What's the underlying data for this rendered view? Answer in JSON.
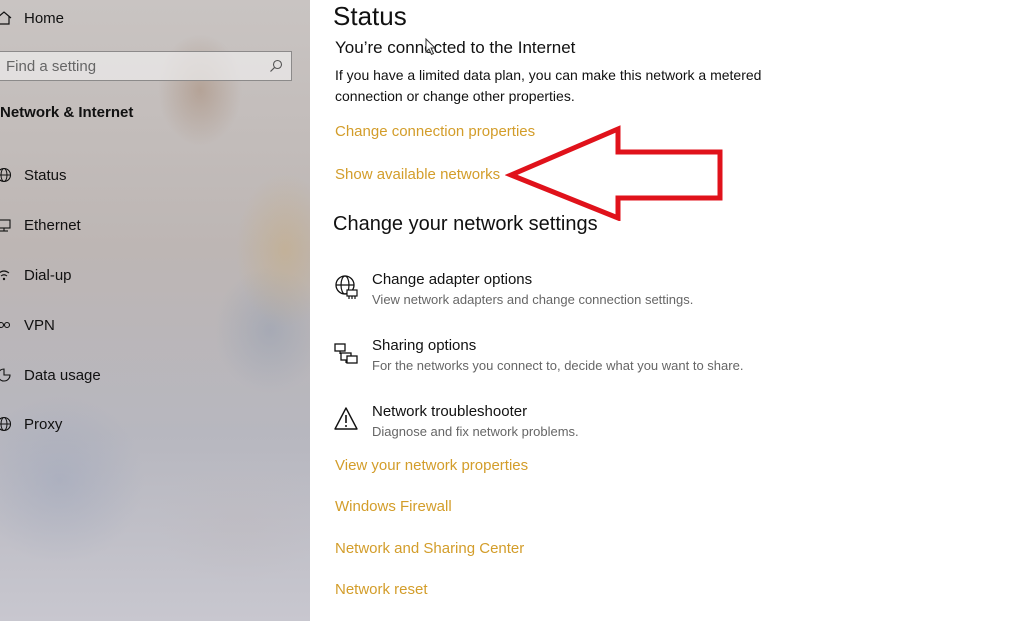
{
  "sidebar": {
    "home_label": "Home",
    "search_placeholder": "Find a setting",
    "section_title": "Network & Internet",
    "items": [
      {
        "label": "Status",
        "icon": "globe-icon"
      },
      {
        "label": "Ethernet",
        "icon": "ethernet-icon"
      },
      {
        "label": "Dial-up",
        "icon": "dialup-icon"
      },
      {
        "label": "VPN",
        "icon": "vpn-icon"
      },
      {
        "label": "Data usage",
        "icon": "data-usage-icon"
      },
      {
        "label": "Proxy",
        "icon": "proxy-icon"
      }
    ]
  },
  "main": {
    "title": "Status",
    "status_heading": "You’re connected to the Internet",
    "status_desc": "If you have a limited data plan, you can make this network a metered connection or change other properties.",
    "links_top": [
      "Change connection properties",
      "Show available networks"
    ],
    "section_heading": "Change your network settings",
    "options": [
      {
        "title": "Change adapter options",
        "subtitle": "View network adapters and change connection settings.",
        "icon": "adapter-icon"
      },
      {
        "title": "Sharing options",
        "subtitle": "For the networks you connect to, decide what you want to share.",
        "icon": "sharing-icon"
      },
      {
        "title": "Network troubleshooter",
        "subtitle": "Diagnose and fix network problems.",
        "icon": "warning-icon"
      }
    ],
    "links_bottom": [
      "View your network properties",
      "Windows Firewall",
      "Network and Sharing Center",
      "Network reset"
    ]
  },
  "colors": {
    "link": "#d39d2a",
    "annotation_arrow": "#e0121b"
  }
}
